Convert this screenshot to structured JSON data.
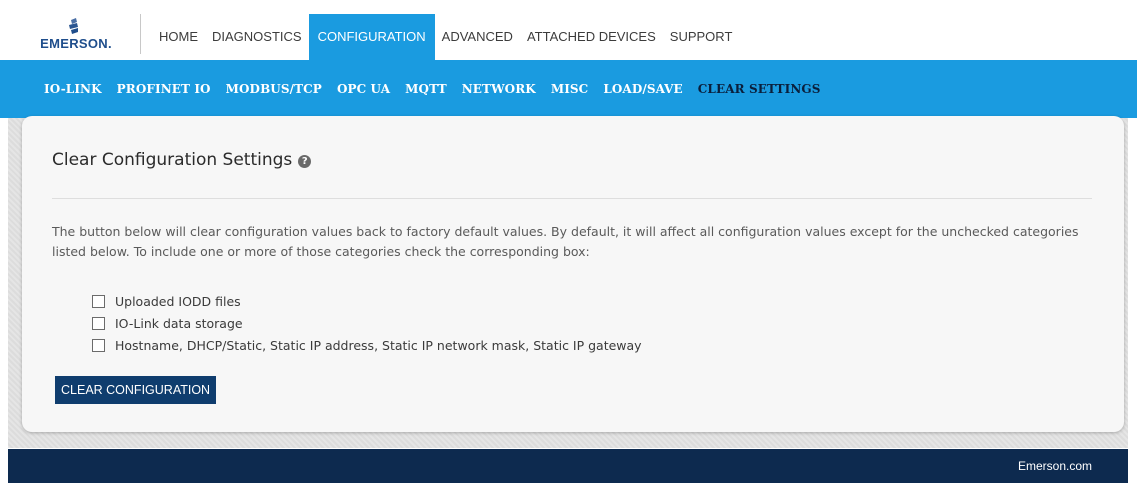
{
  "brand": {
    "name": "EMERSON."
  },
  "main_nav": [
    {
      "label": "HOME",
      "active": false
    },
    {
      "label": "DIAGNOSTICS",
      "active": false
    },
    {
      "label": "CONFIGURATION",
      "active": true
    },
    {
      "label": "ADVANCED",
      "active": false
    },
    {
      "label": "ATTACHED DEVICES",
      "active": false
    },
    {
      "label": "SUPPORT",
      "active": false
    }
  ],
  "sub_nav": [
    {
      "label": "IO-LINK",
      "active": false
    },
    {
      "label": "PROFINET IO",
      "active": false
    },
    {
      "label": "MODBUS/TCP",
      "active": false
    },
    {
      "label": "OPC UA",
      "active": false
    },
    {
      "label": "MQTT",
      "active": false
    },
    {
      "label": "NETWORK",
      "active": false
    },
    {
      "label": "MISC",
      "active": false
    },
    {
      "label": "LOAD/SAVE",
      "active": false
    },
    {
      "label": "CLEAR SETTINGS",
      "active": true
    }
  ],
  "panel": {
    "title": "Clear Configuration Settings",
    "help_icon": "question-circle-icon",
    "description": "The button below will clear configuration values back to factory default values. By default, it will affect all configuration values except for the unchecked categories listed below. To include one or more of those categories check the corresponding box:",
    "options": [
      {
        "label": "Uploaded IODD files",
        "checked": false
      },
      {
        "label": "IO-Link data storage",
        "checked": false
      },
      {
        "label": "Hostname, DHCP/Static, Static IP address, Static IP network mask, Static IP gateway",
        "checked": false
      }
    ],
    "button_label": "CLEAR CONFIGURATION"
  },
  "footer": {
    "link": "Emerson.com"
  },
  "colors": {
    "accent": "#1a9be0",
    "dark_navy": "#0d2a4f",
    "button": "#0f3d6e",
    "active_sub": "#0a1f3c"
  }
}
